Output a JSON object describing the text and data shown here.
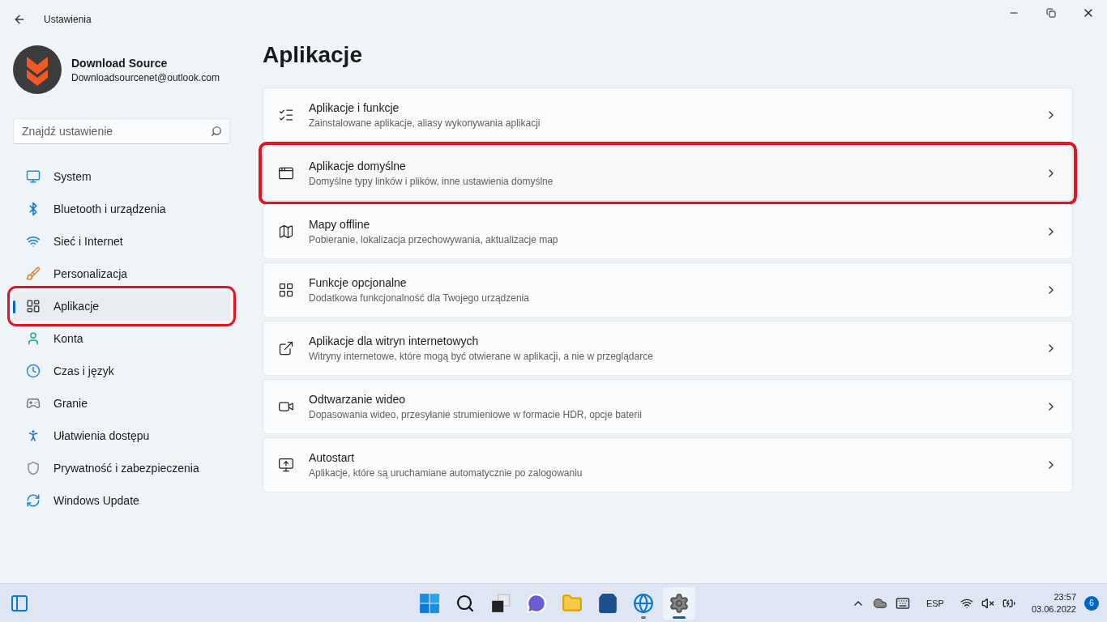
{
  "window": {
    "title": "Ustawienia"
  },
  "account": {
    "name": "Download Source",
    "email": "Downloadsourcenet@outlook.com"
  },
  "search": {
    "placeholder": "Znajdź ustawienie"
  },
  "sidebar": {
    "items": [
      {
        "label": "System",
        "selected": false,
        "highlighted": false
      },
      {
        "label": "Bluetooth i urządzenia",
        "selected": false,
        "highlighted": false
      },
      {
        "label": "Sieć i Internet",
        "selected": false,
        "highlighted": false
      },
      {
        "label": "Personalizacja",
        "selected": false,
        "highlighted": false
      },
      {
        "label": "Aplikacje",
        "selected": true,
        "highlighted": true
      },
      {
        "label": "Konta",
        "selected": false,
        "highlighted": false
      },
      {
        "label": "Czas i język",
        "selected": false,
        "highlighted": false
      },
      {
        "label": "Granie",
        "selected": false,
        "highlighted": false
      },
      {
        "label": "Ułatwienia dostępu",
        "selected": false,
        "highlighted": false
      },
      {
        "label": "Prywatność i zabezpieczenia",
        "selected": false,
        "highlighted": false
      },
      {
        "label": "Windows Update",
        "selected": false,
        "highlighted": false
      }
    ]
  },
  "page": {
    "title": "Aplikacje",
    "cards": [
      {
        "title": "Aplikacje i funkcje",
        "description": "Zainstalowane aplikacje, aliasy wykonywania aplikacji",
        "highlighted": false
      },
      {
        "title": "Aplikacje domyślne",
        "description": "Domyślne typy linków i plików, inne ustawienia domyślne",
        "highlighted": true
      },
      {
        "title": "Mapy offline",
        "description": "Pobieranie, lokalizacja przechowywania, aktualizacje map",
        "highlighted": false
      },
      {
        "title": "Funkcje opcjonalne",
        "description": "Dodatkowa funkcjonalność dla Twojego urządzenia",
        "highlighted": false
      },
      {
        "title": "Aplikacje dla witryn internetowych",
        "description": "Witryny internetowe, które mogą być otwierane w aplikacji, a nie w przeglądarce",
        "highlighted": false
      },
      {
        "title": "Odtwarzanie wideo",
        "description": "Dopasowania wideo, przesyłanie strumieniowe w formacie HDR, opcje baterii",
        "highlighted": false
      },
      {
        "title": "Autostart",
        "description": "Aplikacje, które są uruchamiane automatycznie po zalogowaniu",
        "highlighted": false
      }
    ]
  },
  "taskbar": {
    "apps": [
      {
        "selected": false,
        "running": false
      },
      {
        "selected": false,
        "running": false
      },
      {
        "selected": false,
        "running": false
      },
      {
        "selected": false,
        "running": false
      },
      {
        "selected": false,
        "running": false
      },
      {
        "selected": false,
        "running": false
      },
      {
        "selected": false,
        "running": true
      },
      {
        "selected": true,
        "running": true
      }
    ],
    "language": "ESP",
    "time": "23:57",
    "date": "03.06.2022",
    "notifications": "6"
  }
}
